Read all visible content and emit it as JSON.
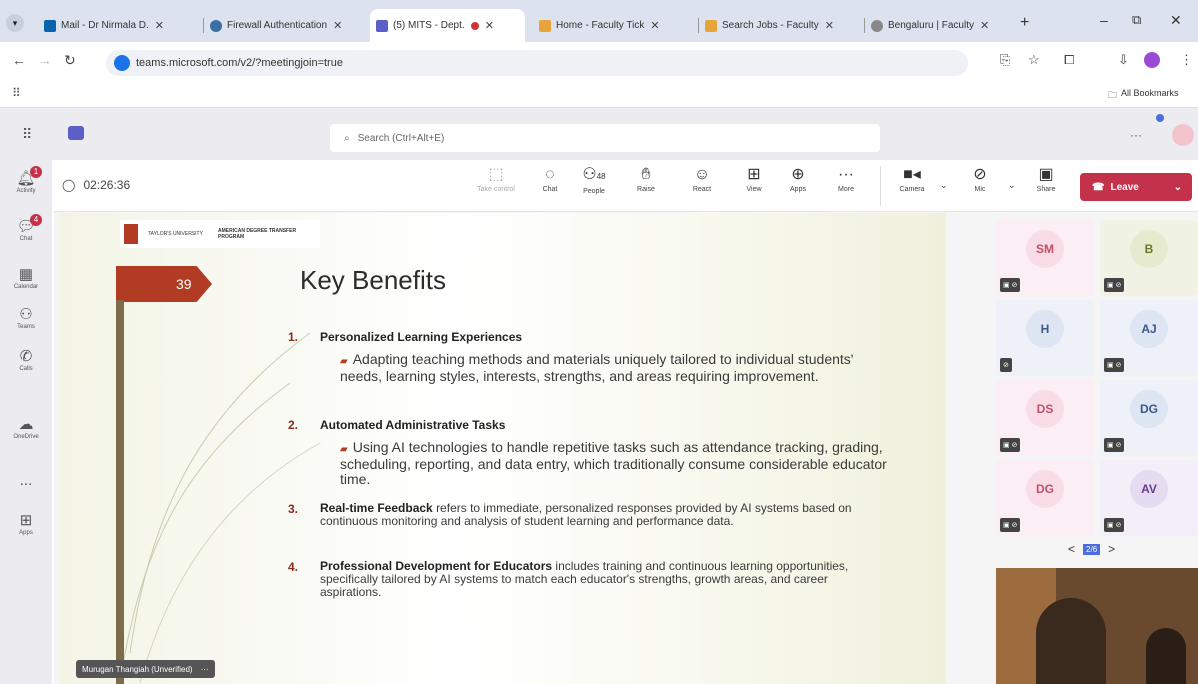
{
  "browser": {
    "tabs": [
      {
        "label": "Mail - Dr Nirmala D."
      },
      {
        "label": "Firewall Authentication"
      },
      {
        "label": "(5) MITS - Dept."
      },
      {
        "label": "Home - Faculty Tick"
      },
      {
        "label": "Search Jobs - Faculty"
      },
      {
        "label": "Bengaluru | Faculty"
      }
    ],
    "new_tab": "+",
    "url": "teams.microsoft.com/v2/?meetingjoin=true",
    "all_bookmarks": "All Bookmarks"
  },
  "teams": {
    "search_placeholder": "Search (Ctrl+Alt+E)",
    "rail": [
      {
        "label": "Activity",
        "badge": "1"
      },
      {
        "label": "Chat",
        "badge": "4"
      },
      {
        "label": "Calendar"
      },
      {
        "label": "Teams"
      },
      {
        "label": "Calls"
      },
      {
        "label": "OneDrive"
      },
      {
        "label": "..."
      },
      {
        "label": "Apps"
      }
    ],
    "timer": "02:26:36",
    "toolbar": {
      "take_control": "Take control",
      "chat": "Chat",
      "people": "People",
      "people_count": "48",
      "raise": "Raise",
      "react": "React",
      "view": "View",
      "apps": "Apps",
      "more": "More",
      "camera": "Camera",
      "mic": "Mic",
      "share": "Share",
      "leave": "Leave"
    }
  },
  "slide": {
    "logo_left": "TAYLOR'S UNIVERSITY",
    "logo_right": "AMERICAN DEGREE TRANSFER PROGRAM",
    "number": "39",
    "title": "Key Benefits",
    "items": [
      {
        "num": "1.",
        "head": "Personalized Learning Experiences",
        "sub": "Adapting teaching methods and materials uniquely tailored to individual students' needs, learning styles, interests, strengths, and areas requiring improvement."
      },
      {
        "num": "2.",
        "head": "Automated Administrative Tasks",
        "sub": "Using AI technologies to handle repetitive tasks such as attendance tracking, grading, scheduling, reporting, and data entry, which traditionally consume considerable educator time."
      },
      {
        "num": "3.",
        "head": "Real-time Feedback",
        "rest": "refers to immediate, personalized responses provided by AI systems based on continuous monitoring and analysis of student learning and performance data."
      },
      {
        "num": "4.",
        "head": "Professional Development for Educators",
        "rest": "includes training and continuous learning opportunities, specifically tailored by AI systems to match each educator's strengths, growth areas, and career aspirations."
      }
    ],
    "presenter": "Murugan Thangiah (Unverified)"
  },
  "participants": [
    {
      "initials": "SM",
      "color": "#c2506a"
    },
    {
      "initials": "B",
      "color": "#6a7a2a"
    },
    {
      "initials": "H",
      "color": "#3a5a8a"
    },
    {
      "initials": "AJ",
      "color": "#3a5a8a"
    },
    {
      "initials": "DS",
      "color": "#c2506a"
    },
    {
      "initials": "DG",
      "color": "#3a5a8a"
    },
    {
      "initials": "DG",
      "color": "#c2506a"
    },
    {
      "initials": "AV",
      "color": "#6a3a8a"
    }
  ],
  "pager": {
    "prev": "<",
    "page": "2/6",
    "next": ">"
  }
}
